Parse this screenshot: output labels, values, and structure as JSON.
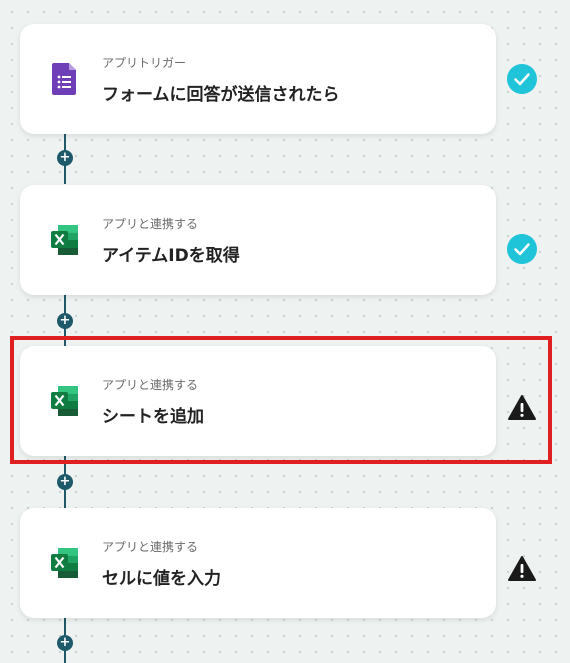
{
  "steps": [
    {
      "subtitle": "アプリトリガー",
      "title": "フォームに回答が送信されたら",
      "app_icon": "google-forms-icon",
      "status": "check-icon"
    },
    {
      "subtitle": "アプリと連携する",
      "title": "アイテムIDを取得",
      "app_icon": "excel-icon",
      "status": "check-icon"
    },
    {
      "subtitle": "アプリと連携する",
      "title": "シートを追加",
      "app_icon": "excel-icon",
      "status": "warning-icon"
    },
    {
      "subtitle": "アプリと連携する",
      "title": "セルに値を入力",
      "app_icon": "excel-icon",
      "status": "warning-icon"
    }
  ],
  "add_step_label": "+",
  "colors": {
    "connector": "#1e5a6a",
    "check": "#1fc4d8",
    "warning": "#1a1a1a",
    "highlight": "#e02020",
    "forms_purple": "#6f3fb8",
    "excel_green": "#1d6f42"
  }
}
